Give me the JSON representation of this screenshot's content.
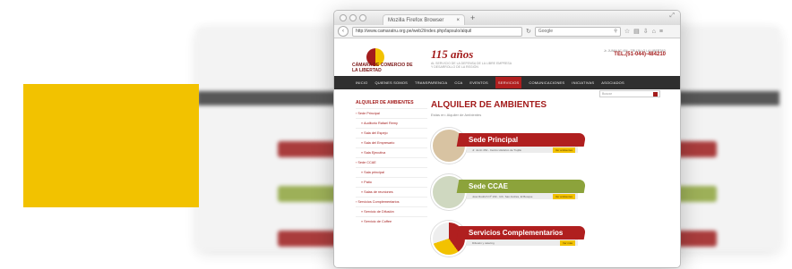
{
  "browser": {
    "title": "Mozilla Firefox Browser",
    "new_tab": "+",
    "url": "http://www.camaratru.org.pe/web2/index.php/lapsulo/alquil",
    "search_placeholder": "Google"
  },
  "header": {
    "org": "CÁMARA DE COMERCIO DE LA LIBERTAD",
    "anniversary": "115 años",
    "anniversary_sub": "AL SERVICIO DE LA DEFENSA DE LA LIBRE EMPRESA Y DESARROLLO DE LA REGIÓN",
    "contact": "Jr. JUNIN N° 454 - TRUJILLO LA LIBERTAD",
    "phone": "TEL.(51-044)-484210"
  },
  "menu": [
    "INICIO",
    "QUIENES SOMOS",
    "TRANSPARENCIA",
    "CCA",
    "EVENTOS",
    "SERVICIOS",
    "COMUNICACIONES",
    "INICIATIVAS",
    "ASOCIADOS"
  ],
  "search_label": "Buscar",
  "sidebar": {
    "title": "ALQUILER DE AMBIENTES",
    "items": [
      {
        "label": "› Sede Principal",
        "sub": false
      },
      {
        "label": "» Auditorio Rafael Remy",
        "sub": true
      },
      {
        "label": "» Sala del Espejo",
        "sub": true
      },
      {
        "label": "» Sala del Empresario",
        "sub": true
      },
      {
        "label": "» Sala Ejecutiva",
        "sub": true
      },
      {
        "label": "› Sede CCAE",
        "sub": false
      },
      {
        "label": "» Sala principal",
        "sub": true
      },
      {
        "label": "» Patio",
        "sub": true
      },
      {
        "label": "» Salas de reuniones",
        "sub": true
      },
      {
        "label": "› Servicios Complementarios",
        "sub": false
      },
      {
        "label": "» Servicio de Difusión",
        "sub": true
      },
      {
        "label": "» Servicio de Coffee",
        "sub": true
      }
    ]
  },
  "main": {
    "title": "ALQUILER DE AMBIENTES",
    "crumb": "Estás en: Alquiler de Ambientes",
    "cards": [
      {
        "label": "Sede Principal",
        "strip": "Jr. Junín 454 - Centro Histórico de Trujillo",
        "more": "Ver ambientes",
        "color": "#b01f1f"
      },
      {
        "label": "Sede CCAE",
        "strip": "José Rodrich Nº 169 - Urb. San Andrés, El Bosque",
        "more": "Ver ambientes",
        "color": "#8ca33b"
      },
      {
        "label": "Servicios Complementarios",
        "strip": "Difusión y catering",
        "more": "Ver más",
        "color": "#b01f1f"
      }
    ]
  },
  "colors": {
    "accent": "#a31c1c",
    "yellow": "#f2c200",
    "green": "#8ca33b",
    "menu_bg": "#2f2f2f"
  }
}
